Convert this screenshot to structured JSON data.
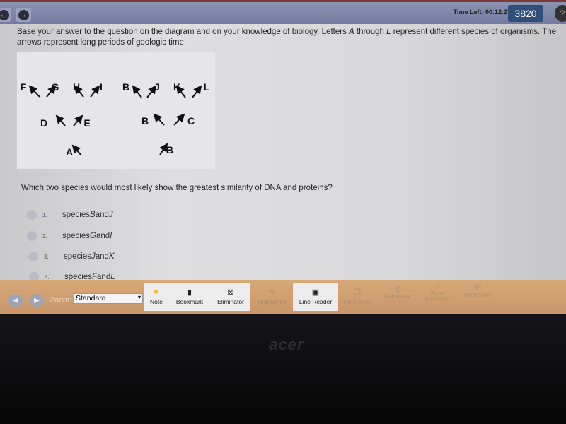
{
  "header": {
    "timer": "Time Left: 00:12:27",
    "score": "3820",
    "help": "?"
  },
  "stem": {
    "part1": "Base your answer to the question on the diagram and on your knowledge of biology. Letters ",
    "a": "A",
    "part2": " through ",
    "l": "L",
    "part3": " represent different species of organisms. The arrows represent long periods of geologic time."
  },
  "diagram": {
    "labels": [
      "F",
      "G",
      "H",
      "I",
      "D",
      "E",
      "A",
      "A",
      "B",
      "J",
      "K",
      "L",
      "B",
      "C",
      "B",
      "B"
    ]
  },
  "question": "Which two species would most likely show the greatest similarity of DNA and proteins?",
  "choices": [
    {
      "num": "1.",
      "pre": "species ",
      "x": "B",
      "mid": " and ",
      "y": "J"
    },
    {
      "num": "2.",
      "pre": "species ",
      "x": "G",
      "mid": " and ",
      "y": "I"
    },
    {
      "num": "3.",
      "pre": "species ",
      "x": "J",
      "mid": " and ",
      "y": "K"
    },
    {
      "num": "4.",
      "pre": "species ",
      "x": "F",
      "mid": " and ",
      "y": "L"
    }
  ],
  "toolbar": {
    "zoom_label": "Zoom:",
    "zoom_value": "Standard",
    "tools": [
      "Note",
      "Bookmark",
      "Eliminator",
      "Highlighter",
      "Line Reader",
      "Reference",
      "Calculator",
      "Ruler",
      "Protractor"
    ],
    "ruler_sub": "Coming soon"
  },
  "bezel": {
    "logo": "acer"
  }
}
